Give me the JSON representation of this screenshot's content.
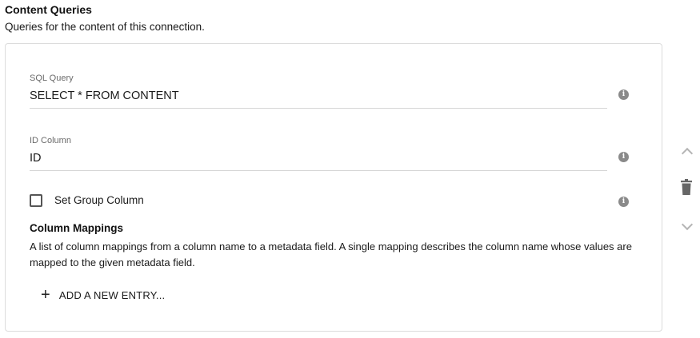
{
  "section": {
    "title": "Content Queries",
    "description": "Queries for the content of this connection."
  },
  "fields": {
    "sql_query": {
      "label": "SQL Query",
      "value": "SELECT * FROM CONTENT"
    },
    "id_column": {
      "label": "ID Column",
      "value": "ID"
    }
  },
  "group_column": {
    "label": "Set Group Column",
    "checked": false
  },
  "column_mappings": {
    "title": "Column Mappings",
    "description": "A list of column mappings from a column name to a metadata field. A single mapping describes the column name whose values are mapped to the given metadata field.",
    "add_label": "ADD A NEW ENTRY..."
  },
  "icons": {
    "info": "info-icon",
    "move_up": "chevron-up-icon",
    "delete": "trash-icon",
    "move_down": "chevron-down-icon"
  },
  "info_glyph": "i"
}
